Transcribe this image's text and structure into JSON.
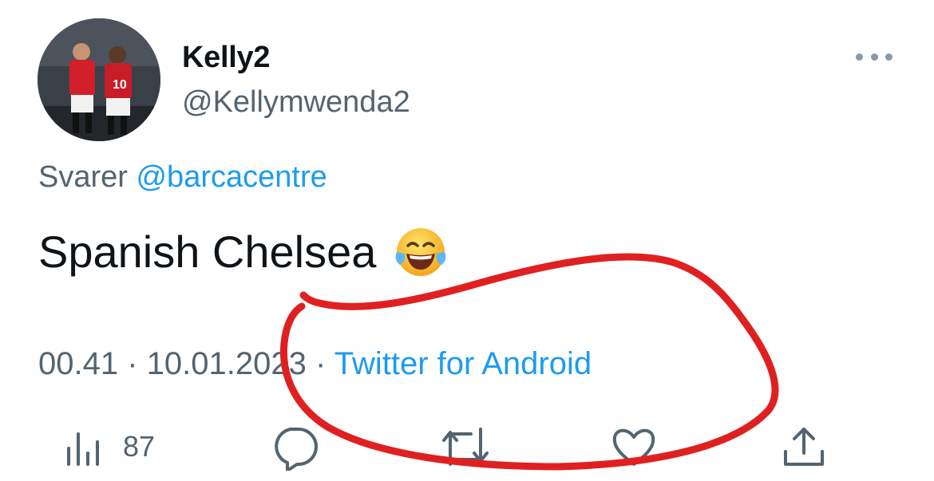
{
  "tweet": {
    "display_name": "Kelly2",
    "handle": "@Kellymwenda2",
    "reply_prefix": "Svarer",
    "reply_to": "@barcacentre",
    "text": "Spanish Chelsea",
    "emoji": "face-with-tears-of-joy",
    "time": "00.41",
    "separator": "·",
    "date": "10.01.2023",
    "source": "Twitter for Android"
  },
  "actions": {
    "views_count": "87",
    "icons": [
      "views-icon",
      "reply-icon",
      "retweet-icon",
      "like-icon",
      "share-icon"
    ]
  },
  "colors": {
    "text": "#0f1419",
    "secondary": "#536471",
    "link": "#1d9bf0",
    "annotation": "#e02020"
  }
}
